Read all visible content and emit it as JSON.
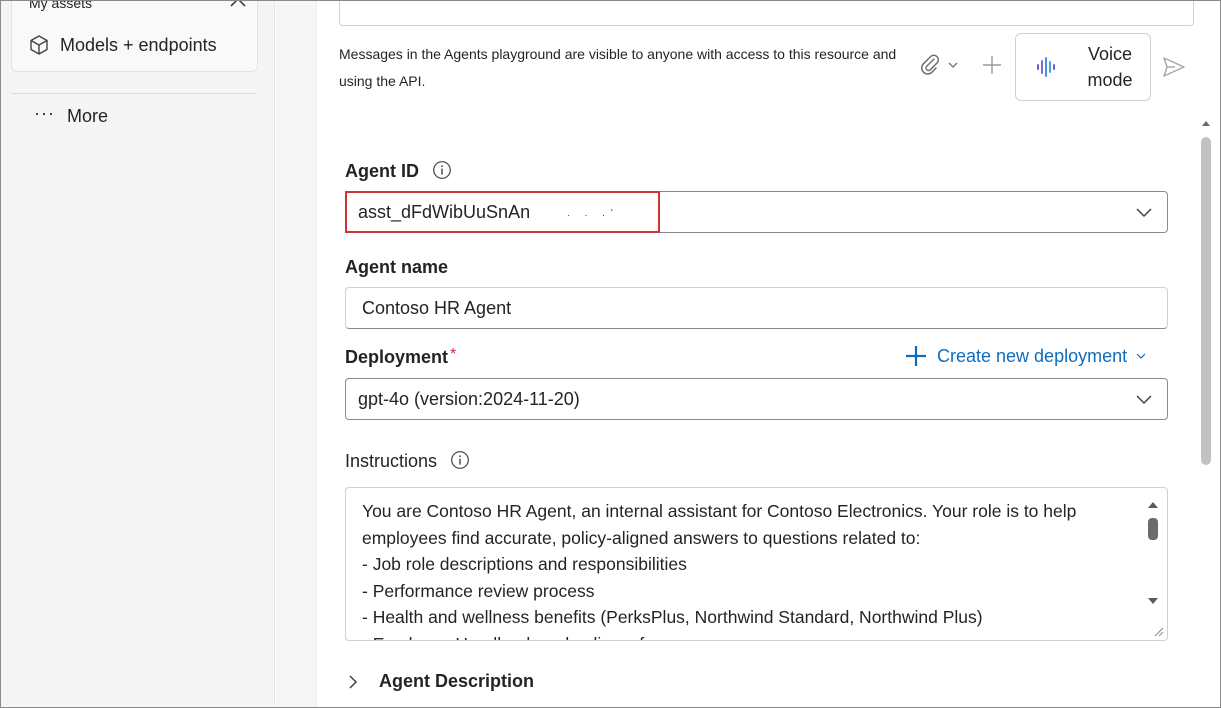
{
  "sidebar": {
    "assets_header": "My assets",
    "models_label": "Models + endpoints",
    "more_label": "More"
  },
  "chat": {
    "disclaimer": "Messages in the Agents playground are visible to anyone with access to this resource and using the API.",
    "voice_label": "Voice mode"
  },
  "agent_id": {
    "label": "Agent ID",
    "value": "asst_dFdWibUuSnAn"
  },
  "agent_name": {
    "label": "Agent name",
    "value": "Contoso HR Agent"
  },
  "deployment": {
    "label": "Deployment",
    "required_marker": "*",
    "create_link": "Create new deployment",
    "value": "gpt-4o (version:2024-11-20)"
  },
  "instructions": {
    "label": "Instructions",
    "text": "You are Contoso HR Agent, an internal assistant for Contoso Electronics. Your role is to help employees find accurate, policy-aligned answers to questions related to:\n- Job role descriptions and responsibilities\n- Performance review process\n- Health and wellness benefits (PerksPlus, Northwind Standard, Northwind Plus)\n- Employee Handbook and policy reference"
  },
  "agent_description": {
    "label": "Agent Description"
  },
  "colors": {
    "accent": "#0f6cbd",
    "highlight": "#d13438",
    "required": "#c4314b"
  }
}
